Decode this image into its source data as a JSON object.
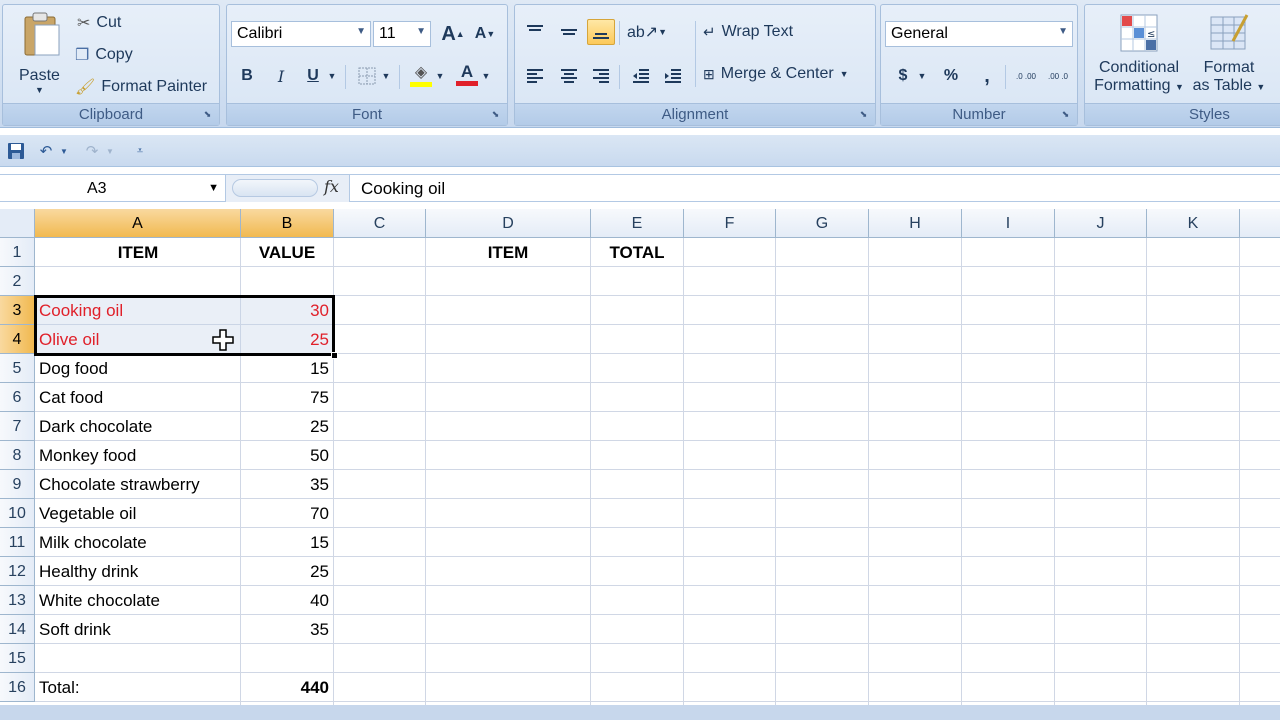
{
  "ribbon": {
    "clipboard": {
      "paste": "Paste",
      "cut": "Cut",
      "copy": "Copy",
      "format_painter": "Format Painter",
      "label": "Clipboard"
    },
    "font": {
      "name": "Calibri",
      "size": "11",
      "grow": "A",
      "shrink": "A",
      "bold": "B",
      "italic": "I",
      "underline": "U",
      "font_color_letter": "A",
      "label": "Font"
    },
    "alignment": {
      "wrap_text": "Wrap Text",
      "merge_center": "Merge & Center",
      "label": "Alignment"
    },
    "number": {
      "format": "General",
      "currency": "$",
      "percent": "%",
      "comma": ",",
      "increase_decimal": ".0 .00",
      "decrease_decimal": ".00 .0",
      "label": "Number"
    },
    "styles": {
      "conditional_formatting_line1": "Conditional",
      "conditional_formatting_line2": "Formatting",
      "format_as_table_line1": "Format",
      "format_as_table_line2": "as Table",
      "label": "Styles"
    }
  },
  "formula_bar": {
    "name_box": "A3",
    "fx": "fx",
    "content": "Cooking oil"
  },
  "columns": [
    "A",
    "B",
    "C",
    "D",
    "E",
    "F",
    "G",
    "H",
    "I",
    "J",
    "K"
  ],
  "rows": [
    "1",
    "2",
    "3",
    "4",
    "5",
    "6",
    "7",
    "8",
    "9",
    "10",
    "11",
    "12",
    "13",
    "14",
    "15",
    "16"
  ],
  "sheet": {
    "header_item": "ITEM",
    "header_value": "VALUE",
    "header_item_d": "ITEM",
    "header_total": "TOTAL",
    "items": [
      {
        "name": "Cooking oil",
        "value": "30"
      },
      {
        "name": "Olive oil",
        "value": "25"
      },
      {
        "name": "Dog food",
        "value": "15"
      },
      {
        "name": "Cat food",
        "value": "75"
      },
      {
        "name": "Dark chocolate",
        "value": "25"
      },
      {
        "name": "Monkey food",
        "value": "50"
      },
      {
        "name": "Chocolate strawberry",
        "value": "35"
      },
      {
        "name": "Vegetable oil",
        "value": "70"
      },
      {
        "name": "Milk chocolate",
        "value": "15"
      },
      {
        "name": "Healthy drink",
        "value": "25"
      },
      {
        "name": "White chocolate",
        "value": "40"
      },
      {
        "name": "Soft drink",
        "value": "35"
      }
    ],
    "total_label": "Total:",
    "total_value": "440"
  },
  "colors": {
    "highlight_text": "#e0202a",
    "selected_header": "#f1b950"
  }
}
